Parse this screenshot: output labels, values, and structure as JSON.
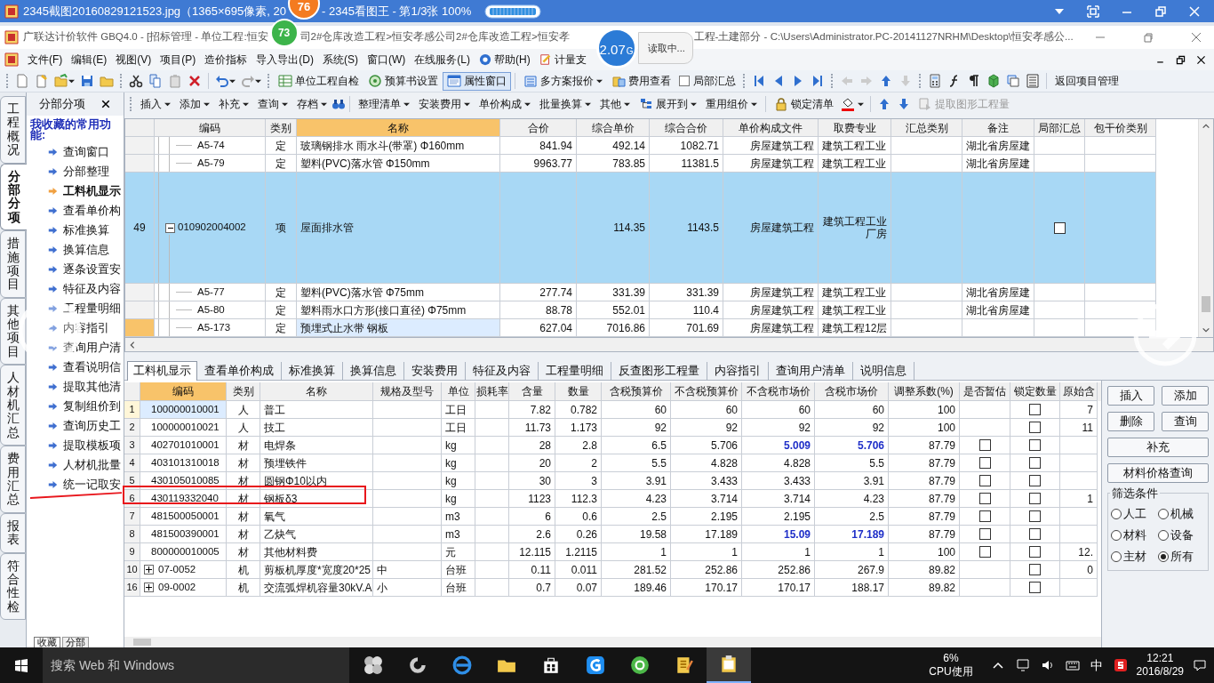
{
  "viewer": {
    "title_parts": [
      "2345截图20160829121523.jpg（1365×695像素, 20",
      "- 2345看图王 - 第1/3张 100%"
    ]
  },
  "memory_badges": [
    {
      "value": "76",
      "color": "#f47b20"
    },
    {
      "value": "73",
      "color": "#3cb44a"
    }
  ],
  "memory_bubble": {
    "value": "2.07",
    "unit": "G",
    "status": "读取中..."
  },
  "app": {
    "title_parts": [
      "广联达计价软件 GBQ4.0 - [招标管理 - 单位工程:恒安",
      "司2#仓库改造工程>恒安孝感公司2#仓库改造工程>恒安孝",
      "工程-土建部分 - C:\\Users\\Administrator.PC-20141127NRHM\\Desktop\\恒安孝感公..."
    ]
  },
  "menu": [
    "文件(F)",
    "编辑(E)",
    "视图(V)",
    "项目(P)",
    "造价指标",
    "导入导出(D)",
    "系统(S)",
    "窗口(W)",
    "在线服务(L)",
    "帮助(H)",
    "计量支"
  ],
  "toolbar_1": [
    {
      "label": "单位工程自检",
      "kind": "button",
      "pressed": false
    },
    {
      "label": "预算书设置",
      "kind": "button",
      "pressed": false
    },
    {
      "label": "属性窗口",
      "kind": "button",
      "pressed": true
    },
    {
      "label": "多方案报价",
      "kind": "dropdown",
      "pressed": false
    },
    {
      "label": "费用查看",
      "kind": "button",
      "pressed": false
    },
    {
      "label": "局部汇总",
      "kind": "checkbox",
      "checked": false
    },
    {
      "label": "返回项目管理",
      "kind": "button",
      "pressed": false
    }
  ],
  "toolbar_2": [
    {
      "label": "插入",
      "dropdown": true,
      "disabled": false
    },
    {
      "label": "添加",
      "dropdown": true,
      "disabled": false
    },
    {
      "label": "补充",
      "dropdown": true,
      "disabled": false
    },
    {
      "label": "查询",
      "dropdown": true,
      "disabled": false
    },
    {
      "label": "存档",
      "dropdown": true,
      "disabled": false
    },
    {
      "label": "整理清单",
      "dropdown": true,
      "disabled": false
    },
    {
      "label": "安装费用",
      "dropdown": true,
      "disabled": false
    },
    {
      "label": "单价构成",
      "dropdown": true,
      "disabled": false
    },
    {
      "label": "批量换算",
      "dropdown": true,
      "disabled": false
    },
    {
      "label": "其他",
      "dropdown": true,
      "disabled": false
    },
    {
      "label": "展开到",
      "dropdown": true,
      "disabled": false
    },
    {
      "label": "重用组价",
      "dropdown": true,
      "disabled": false
    },
    {
      "label": "锁定清单",
      "dropdown": false,
      "disabled": false
    },
    {
      "label": "提取图形工程量",
      "dropdown": false,
      "disabled": true
    }
  ],
  "side_tabs": [
    {
      "label": "工程概况",
      "selected": false
    },
    {
      "label": "分部分项",
      "selected": true
    },
    {
      "label": "措施项目",
      "selected": false
    },
    {
      "label": "其他项目",
      "selected": false
    },
    {
      "label": "人材机汇总",
      "selected": false
    },
    {
      "label": "费用汇总",
      "selected": false
    },
    {
      "label": "报表",
      "selected": false
    },
    {
      "label": "符合性检",
      "selected": false
    }
  ],
  "sidebar": {
    "title": "分部分项",
    "heading": "我收藏的常用功能:",
    "items": [
      {
        "label": "查询窗口",
        "selected": false
      },
      {
        "label": "分部整理",
        "selected": false
      },
      {
        "label": "工料机显示",
        "selected": true
      },
      {
        "label": "查看单价构",
        "selected": false
      },
      {
        "label": "标准换算",
        "selected": false
      },
      {
        "label": "换算信息",
        "selected": false
      },
      {
        "label": "逐条设置安",
        "selected": false
      },
      {
        "label": "特征及内容",
        "selected": false
      },
      {
        "label": "工程量明细",
        "selected": false
      },
      {
        "label": "内容指引",
        "selected": false
      },
      {
        "label": "查询用户清",
        "selected": false
      },
      {
        "label": "查看说明信",
        "selected": false
      },
      {
        "label": "提取其他清",
        "selected": false
      },
      {
        "label": "复制组价到",
        "selected": false
      },
      {
        "label": "查询历史工",
        "selected": false
      },
      {
        "label": "提取模板项",
        "selected": false
      },
      {
        "label": "人材机批量",
        "selected": false
      },
      {
        "label": "统一记取安",
        "selected": false
      }
    ],
    "bottom_tabs": [
      {
        "label": "收藏",
        "selected": true
      },
      {
        "label": "分部",
        "selected": false
      }
    ]
  },
  "bill_table": {
    "columns": [
      {
        "label": "编码",
        "selected": false
      },
      {
        "label": "类别",
        "selected": false
      },
      {
        "label": "名称",
        "selected": true
      },
      {
        "label": "合价",
        "selected": false
      },
      {
        "label": "综合单价",
        "selected": false
      },
      {
        "label": "综合合价",
        "selected": false
      },
      {
        "label": "单价构成文件",
        "selected": false
      },
      {
        "label": "取费专业",
        "selected": false
      },
      {
        "label": "汇总类别",
        "selected": false
      },
      {
        "label": "备注",
        "selected": false
      },
      {
        "label": "局部汇总",
        "selected": false
      },
      {
        "label": "包干价类别",
        "selected": false
      }
    ],
    "rows": [
      {
        "kind": "quota",
        "code": "A5-74",
        "type": "定",
        "name": "玻璃钢排水 雨水斗(带罩) Φ160mm",
        "total": "841.94",
        "unit_price": "492.14",
        "combined_total": "1082.71",
        "price_file": "房屋建筑工程",
        "fee_major": "建筑工程工业",
        "remark": "湖北省房屋建",
        "selected": false,
        "current": false
      },
      {
        "kind": "quota",
        "code": "A5-79",
        "type": "定",
        "name": "塑料(PVC)落水管 Φ150mm",
        "total": "9963.77",
        "unit_price": "783.85",
        "combined_total": "11381.5",
        "price_file": "房屋建筑工程",
        "fee_major": "建筑工程工业",
        "remark": "湖北省房屋建",
        "selected": false,
        "current": false
      },
      {
        "kind": "bill",
        "number": "49",
        "code": "010902004002",
        "type": "项",
        "name": "屋面排水管",
        "unit_price": "114.35",
        "combined_total": "1143.5",
        "price_file": "房屋建筑工程",
        "fee_major": "建筑工程工业厂房",
        "local_summary": false,
        "expanded": true,
        "selected": true,
        "current": false,
        "children": [
          {
            "kind": "quota",
            "code": "A5-77",
            "type": "定",
            "name": "塑料(PVC)落水管 Φ75mm",
            "total": "277.74",
            "unit_price": "331.39",
            "combined_total": "331.39",
            "price_file": "房屋建筑工程",
            "fee_major": "建筑工程工业",
            "remark": "湖北省房屋建",
            "selected": false,
            "current": false
          },
          {
            "kind": "quota",
            "code": "A5-80",
            "type": "定",
            "name": "塑料雨水口方形(接口直径) Φ75mm",
            "total": "88.78",
            "unit_price": "552.01",
            "combined_total": "110.4",
            "price_file": "房屋建筑工程",
            "fee_major": "建筑工程工业",
            "remark": "湖北省房屋建",
            "selected": false,
            "current": false
          },
          {
            "kind": "quota",
            "code": "A5-173",
            "type": "定",
            "name": "预埋式止水带 钢板",
            "total": "627.04",
            "unit_price": "7016.86",
            "combined_total": "701.69",
            "price_file": "房屋建筑工程",
            "fee_major": "建筑工程12层",
            "selected": false,
            "current": true
          }
        ]
      }
    ]
  },
  "detail_tabs": [
    {
      "label": "工料机显示",
      "selected": true
    },
    {
      "label": "查看单价构成",
      "selected": false
    },
    {
      "label": "标准换算",
      "selected": false
    },
    {
      "label": "换算信息",
      "selected": false
    },
    {
      "label": "安装费用",
      "selected": false
    },
    {
      "label": "特征及内容",
      "selected": false
    },
    {
      "label": "工程量明细",
      "selected": false
    },
    {
      "label": "反查图形工程量",
      "selected": false
    },
    {
      "label": "内容指引",
      "selected": false
    },
    {
      "label": "查询用户清单",
      "selected": false
    },
    {
      "label": "说明信息",
      "selected": false
    }
  ],
  "resource_table": {
    "columns": [
      {
        "label": "编码",
        "selected": true
      },
      {
        "label": "类别",
        "selected": false
      },
      {
        "label": "名称",
        "selected": false
      },
      {
        "label": "规格及型号",
        "selected": false
      },
      {
        "label": "单位",
        "selected": false
      },
      {
        "label": "损耗率",
        "selected": false
      },
      {
        "label": "含量",
        "selected": false
      },
      {
        "label": "数量",
        "selected": false
      },
      {
        "label": "含税预算价",
        "selected": false
      },
      {
        "label": "不含税预算价",
        "selected": false
      },
      {
        "label": "不含税市场价",
        "selected": false
      },
      {
        "label": "含税市场价",
        "selected": false
      },
      {
        "label": "调整系数(%)",
        "selected": false
      },
      {
        "label": "是否暂估",
        "selected": false
      },
      {
        "label": "锁定数量",
        "selected": false
      },
      {
        "label": "原始含",
        "selected": false
      }
    ],
    "rows": [
      {
        "number": "1",
        "code": "100000010001",
        "type": "人",
        "name": "普工",
        "unit": "工日",
        "content": "7.82",
        "quantity": "0.782",
        "tax_budget": "60",
        "notax_budget": "60",
        "notax_market": "60",
        "tax_market": "60",
        "coef": "100",
        "locked": false,
        "original": "7",
        "adjusted": false,
        "current": true
      },
      {
        "number": "2",
        "code": "100000010021",
        "type": "人",
        "name": "技工",
        "unit": "工日",
        "content": "11.73",
        "quantity": "1.173",
        "tax_budget": "92",
        "notax_budget": "92",
        "notax_market": "92",
        "tax_market": "92",
        "coef": "100",
        "locked": false,
        "original": "11",
        "adjusted": false,
        "current": false
      },
      {
        "number": "3",
        "code": "402701010001",
        "type": "材",
        "name": "电焊条",
        "unit": "kg",
        "content": "28",
        "quantity": "2.8",
        "tax_budget": "6.5",
        "notax_budget": "5.706",
        "notax_market": "5.009",
        "tax_market": "5.706",
        "coef": "87.79",
        "provisional": false,
        "locked": false,
        "adjusted": true,
        "current": false
      },
      {
        "number": "4",
        "code": "403101310018",
        "type": "材",
        "name": "预埋铁件",
        "unit": "kg",
        "content": "20",
        "quantity": "2",
        "tax_budget": "5.5",
        "notax_budget": "4.828",
        "notax_market": "4.828",
        "tax_market": "5.5",
        "coef": "87.79",
        "provisional": false,
        "locked": false,
        "adjusted": false,
        "current": false
      },
      {
        "number": "5",
        "code": "430105010085",
        "type": "材",
        "name": "圆钢Φ10以内",
        "unit": "kg",
        "content": "30",
        "quantity": "3",
        "tax_budget": "3.91",
        "notax_budget": "3.433",
        "notax_market": "3.433",
        "tax_market": "3.91",
        "coef": "87.79",
        "provisional": false,
        "locked": false,
        "adjusted": false,
        "current": false
      },
      {
        "number": "6",
        "code": "430119332040",
        "type": "材",
        "name": "钢板δ3",
        "unit": "kg",
        "content": "1123",
        "quantity": "112.3",
        "tax_budget": "4.23",
        "notax_budget": "3.714",
        "notax_market": "3.714",
        "tax_market": "4.23",
        "coef": "87.79",
        "provisional": false,
        "locked": false,
        "original": "1",
        "adjusted": false,
        "current": false
      },
      {
        "number": "7",
        "code": "481500050001",
        "type": "材",
        "name": "氧气",
        "unit": "m3",
        "content": "6",
        "quantity": "0.6",
        "tax_budget": "2.5",
        "notax_budget": "2.195",
        "notax_market": "2.195",
        "tax_market": "2.5",
        "coef": "87.79",
        "provisional": false,
        "locked": false,
        "adjusted": false,
        "current": false
      },
      {
        "number": "8",
        "code": "481500390001",
        "type": "材",
        "name": "乙炔气",
        "unit": "m3",
        "content": "2.6",
        "quantity": "0.26",
        "tax_budget": "19.58",
        "notax_budget": "17.189",
        "notax_market": "15.09",
        "tax_market": "17.189",
        "coef": "87.79",
        "provisional": false,
        "locked": false,
        "adjusted": true,
        "current": false
      },
      {
        "number": "9",
        "code": "800000010005",
        "type": "材",
        "name": "其他材料费",
        "unit": "元",
        "content": "12.115",
        "quantity": "1.2115",
        "tax_budget": "1",
        "notax_budget": "1",
        "notax_market": "1",
        "tax_market": "1",
        "coef": "100",
        "provisional": false,
        "locked": false,
        "original": "12.",
        "adjusted": false,
        "current": false
      },
      {
        "number": "10",
        "code": "07-0052",
        "type": "机",
        "name": "剪板机厚度*宽度20*25",
        "spec": "中",
        "unit": "台班",
        "content": "0.11",
        "quantity": "0.011",
        "tax_budget": "281.52",
        "notax_budget": "252.86",
        "notax_market": "252.86",
        "tax_market": "267.9",
        "coef": "89.82",
        "locked": false,
        "original": "0",
        "expanded": false,
        "adjusted": false,
        "current": false
      },
      {
        "number": "16",
        "code": "09-0002",
        "type": "机",
        "name": "交流弧焊机容量30kV.A",
        "spec": "小",
        "unit": "台班",
        "content": "0.7",
        "quantity": "0.07",
        "tax_budget": "189.46",
        "notax_budget": "170.17",
        "notax_market": "170.17",
        "tax_market": "188.17",
        "coef": "89.82",
        "locked": false,
        "expanded": false,
        "adjusted": false,
        "current": false
      }
    ]
  },
  "side_buttons": [
    {
      "label": "插入",
      "wide": false
    },
    {
      "label": "添加",
      "wide": false
    },
    {
      "label": "删除",
      "wide": false
    },
    {
      "label": "查询",
      "wide": false
    },
    {
      "label": "补充",
      "wide": true
    },
    {
      "label": "材料价格查询",
      "wide": true
    }
  ],
  "filter": {
    "title": "筛选条件",
    "options": [
      {
        "label": "人工",
        "selected": false
      },
      {
        "label": "机械",
        "selected": false
      },
      {
        "label": "材料",
        "selected": false
      },
      {
        "label": "设备",
        "selected": false
      },
      {
        "label": "主材",
        "selected": false
      },
      {
        "label": "所有",
        "selected": true
      }
    ]
  },
  "taskbar": {
    "search_placeholder": "搜索 Web 和 Windows",
    "apps": [
      {
        "active": false
      },
      {
        "active": false
      },
      {
        "active": false
      },
      {
        "active": false
      },
      {
        "active": false
      },
      {
        "active": false
      },
      {
        "active": false
      },
      {
        "active": false
      },
      {
        "active": true
      }
    ],
    "cpu_value": "6%",
    "cpu_label": "CPU使用",
    "ime": "中",
    "time": "12:21",
    "date": "2016/8/29"
  }
}
